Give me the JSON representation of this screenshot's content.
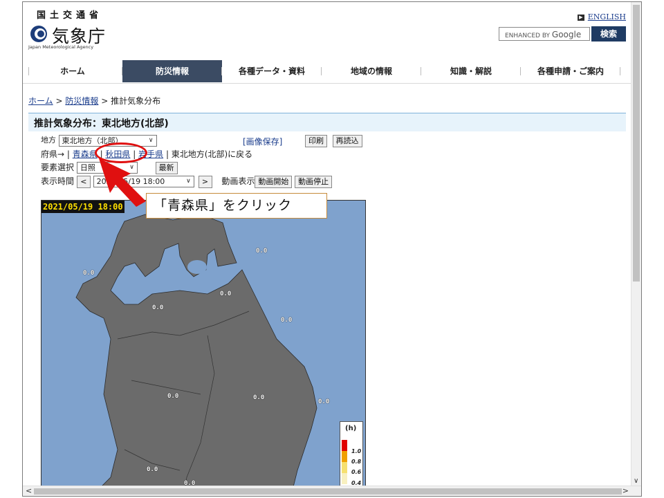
{
  "header": {
    "ministry": "国土交通省",
    "logo_text": "気象庁",
    "logo_sub": "Japan Meteorological Agency",
    "english": "ENGLISH",
    "search_placeholder_small": "ENHANCED BY",
    "search_placeholder_brand": "Google",
    "search_button": "検索"
  },
  "nav": {
    "items": [
      {
        "label": "ホーム"
      },
      {
        "label": "防災情報"
      },
      {
        "label": "各種データ・資料"
      },
      {
        "label": "地域の情報"
      },
      {
        "label": "知識・解説"
      },
      {
        "label": "各種申請・ご案内"
      }
    ],
    "active_index": 1
  },
  "breadcrumb": {
    "home": "ホーム",
    "sep": ">",
    "bosai": "防災情報",
    "current": "推計気象分布"
  },
  "page_title": "推計気象分布：東北地方(北部)",
  "controls": {
    "region_label": "地方",
    "region_value": "東北地方（北部）",
    "save_image": "[画像保存]",
    "print": "印刷",
    "reload": "再読込",
    "pref_label": "府県→",
    "pref_aomori": "青森県",
    "pref_akita": "秋田県",
    "pref_iwate": "岩手県",
    "back_text": "東北地方(北部)に戻る",
    "element_label": "要素選択",
    "element_value": "日照",
    "latest": "最新",
    "time_label": "表示時間",
    "prev": "<",
    "time_value": "2021/05/19 18:00",
    "next": ">",
    "anim_label": "動画表示",
    "anim_start": "動画開始",
    "anim_stop": "動画停止"
  },
  "map": {
    "timestamp": "2021/05/19 18:00",
    "values": [
      "0.0",
      "0.0",
      "0.0",
      "0.0",
      "0.0",
      "0.0",
      "0.0",
      "0.0",
      "0.0",
      "0.0"
    ],
    "legend_unit": "(h)",
    "legend": [
      {
        "label": "1.0",
        "color": "#e00000"
      },
      {
        "label": "0.8",
        "color": "#f0a000"
      },
      {
        "label": "0.6",
        "color": "#f6e070"
      },
      {
        "label": "0.4",
        "color": "#f8f0c0"
      }
    ],
    "sea_color": "#7fa2cd",
    "land_color": "#6b6b6b"
  },
  "annotation": {
    "callout": "「青森県」をクリック"
  }
}
